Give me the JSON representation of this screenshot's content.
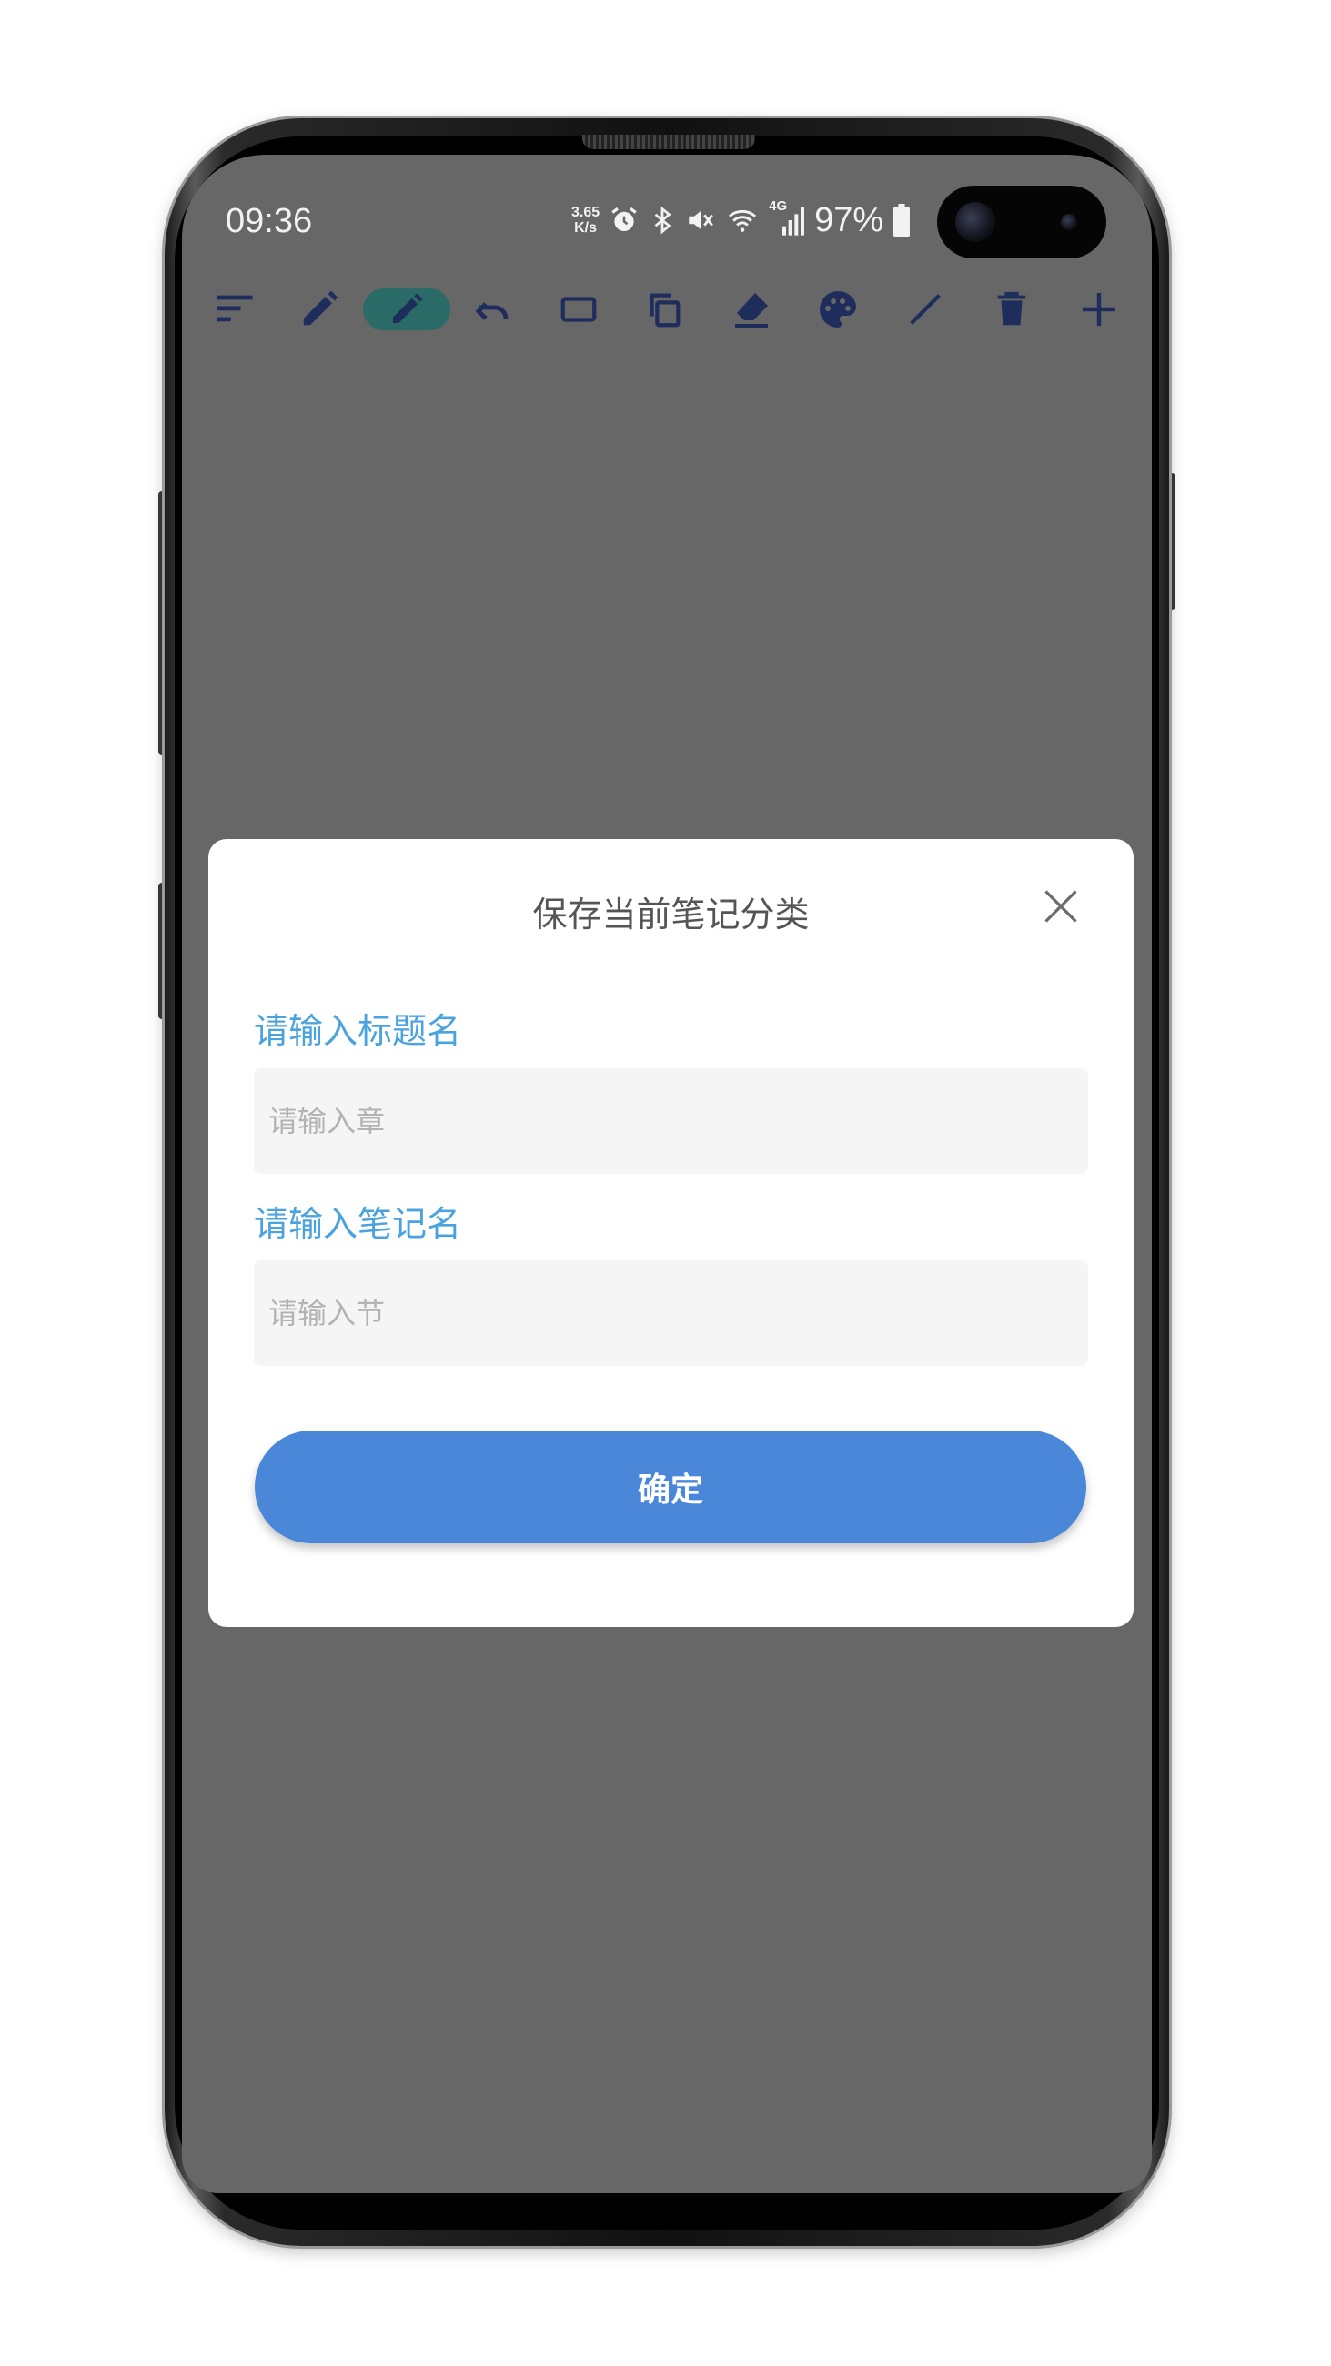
{
  "status_bar": {
    "time": "09:36",
    "net_speed_value": "3.65",
    "net_speed_unit": "K/s",
    "network_type": "4G",
    "battery_percent": "97%"
  },
  "toolbar": {
    "icons": [
      "menu-icon",
      "pencil-icon",
      "highlighter-pencil-icon",
      "undo-icon",
      "rectangle-icon",
      "copy-icon",
      "eraser-icon",
      "palette-icon",
      "line-icon",
      "trash-icon",
      "plus-icon"
    ],
    "active_tool": "highlighter-pencil-icon",
    "active_color": "#2a6b67",
    "icon_color": "#1f2d5c"
  },
  "dialog": {
    "title": "保存当前笔记分类",
    "title_field": {
      "label": "请输入标题名",
      "placeholder": "请输入章",
      "value": ""
    },
    "note_field": {
      "label": "请输入笔记名",
      "placeholder": "请输入节",
      "value": ""
    },
    "confirm_label": "确定",
    "accent_color": "#4a87d9",
    "label_color": "#4aa3df"
  }
}
